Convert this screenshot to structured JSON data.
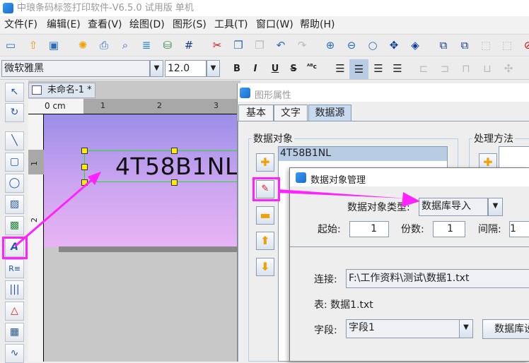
{
  "window": {
    "title": "中琅条码标签打印软件-V6.5.0 试用版 单机"
  },
  "menu": [
    "文件(F)",
    "编辑(E)",
    "查看(V)",
    "绘图(D)",
    "图形(S)",
    "工具(T)",
    "窗口(W)",
    "帮助(H)"
  ],
  "toolbar": {
    "icons": [
      "new-icon",
      "open-icon",
      "save-icon",
      "settings-icon",
      "print-icon",
      "print-preview-icon",
      "database-icon",
      "database-connect-icon",
      "grid-icon",
      "cut-icon",
      "copy-icon",
      "paste-icon",
      "undo-icon",
      "redo-icon",
      "zoom-in-icon",
      "zoom-out-icon",
      "zoom-icon",
      "fit-icon",
      "actual-size-icon",
      "group-icon",
      "ungroup-icon",
      "select-frame-icon",
      "align-frame-icon",
      "delete-icon"
    ]
  },
  "format": {
    "font": "微软雅黑",
    "size": "12.0",
    "bold": "B",
    "italic": "I",
    "underline": "U",
    "strike": "S",
    "special": "ᴬᴮc"
  },
  "document": {
    "tab": "未命名-1 *",
    "ruler_unit": "0 cm",
    "ruler_h": [
      "1",
      "2",
      "3"
    ],
    "ruler_v": [
      "1",
      "2"
    ],
    "text": "4T58B1NL"
  },
  "props": {
    "title": "图形属性",
    "tabs": [
      "基本",
      "文字",
      "数据源"
    ],
    "active_tab": "数据源",
    "group_data": "数据对象",
    "group_process": "处理方法",
    "items": [
      "4T58B1NL"
    ]
  },
  "manager": {
    "title": "数据对象管理",
    "type_label": "数据对象类型:",
    "type_value": "数据库导入",
    "start_label": "起始:",
    "start": "1",
    "count_label": "份数:",
    "count": "1",
    "interval_label": "间隔:",
    "interval": "1",
    "conn_label": "连接:",
    "conn": "F:\\工作资料\\测试\\数据1.txt",
    "table": "表: 数据1.txt",
    "field_label": "字段:",
    "field": "字段1",
    "db_button": "数据库设"
  },
  "colors": {
    "highlight": "#ff22ff",
    "accent": "#b8cce4"
  }
}
